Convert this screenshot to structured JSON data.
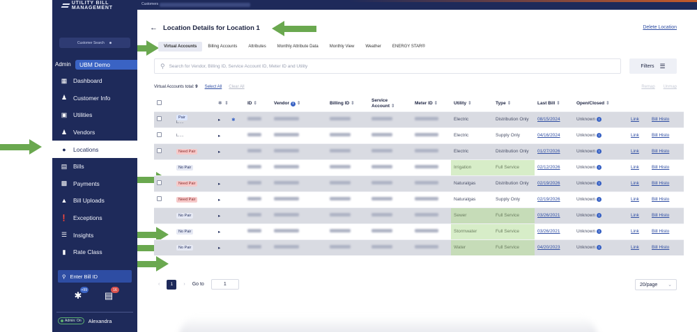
{
  "app": {
    "brand": "UTILITY BILL MANAGEMENT",
    "crumb": "Customers"
  },
  "sidebar": {
    "customer_search": "Customer Search",
    "admin_label": "Admin",
    "org_name": "UBM Demo",
    "items": [
      {
        "label": "Dashboard",
        "icon": "dashboard-icon"
      },
      {
        "label": "Customer Info",
        "icon": "person-icon"
      },
      {
        "label": "Utilities",
        "icon": "lock-icon"
      },
      {
        "label": "Vendors",
        "icon": "person-icon"
      },
      {
        "label": "Locations",
        "icon": "pin-icon",
        "active": true
      },
      {
        "label": "Bills",
        "icon": "bill-icon"
      },
      {
        "label": "Payments",
        "icon": "payment-icon"
      },
      {
        "label": "Bill Uploads",
        "icon": "upload-icon"
      },
      {
        "label": "Exceptions",
        "icon": "alert-icon"
      },
      {
        "label": "Insights",
        "icon": "insights-icon"
      },
      {
        "label": "Rate Class",
        "icon": "rate-icon"
      }
    ],
    "bill_id_placeholder": "Enter Bill ID",
    "notif_badge_1": "+99",
    "notif_badge_2": "16",
    "admin_pill": "Admin: On",
    "user_name": "Alexandra"
  },
  "page": {
    "title": "Location Details for Location 1",
    "delete_link": "Delete Location",
    "tabs": [
      "Virtual Accounts",
      "Billing Accounts",
      "Attributes",
      "Monthly Attribute Data",
      "Monthly View",
      "Weather",
      "ENERGY STAR®"
    ],
    "search_placeholder": "Search for Vendor, Billing ID, Service Account ID, Meter ID and Utility",
    "filters_label": "Filters",
    "totals_label": "Virtual Accounts total:",
    "totals_count": "9",
    "select_all": "Select All",
    "clear_all": "Clear All",
    "remap": "Remap",
    "unmap": "Unmap"
  },
  "table": {
    "headers": [
      "ID",
      "Vendor",
      "Billing ID",
      "Service Account",
      "Meter ID",
      "Utility",
      "Type",
      "Last Bill",
      "Open/Closed"
    ],
    "rows": [
      {
        "pair": "Pair",
        "pair_type": "pair",
        "sub": "L.....",
        "utility": "Electric",
        "type": "Distribution Only",
        "last_bill": "08/15/2024",
        "status": "Unknown",
        "shade": true
      },
      {
        "pair": "",
        "pair_type": "",
        "sub": "L.....",
        "utility": "Electric",
        "type": "Supply Only",
        "last_bill": "04/16/2024",
        "status": "Unknown",
        "shade": false
      },
      {
        "pair": "Need Pair",
        "pair_type": "need",
        "sub": "",
        "utility": "Electric",
        "type": "Distribution Only",
        "last_bill": "01/27/2026",
        "status": "Unknown",
        "shade": true
      },
      {
        "pair": "No Pair",
        "pair_type": "no",
        "sub": "",
        "utility": "Irrigation",
        "type": "Full Service",
        "last_bill": "02/12/2026",
        "status": "Unknown",
        "shade": false,
        "green": true
      },
      {
        "pair": "Need Pair",
        "pair_type": "need",
        "sub": "",
        "utility": "Naturalgas",
        "type": "Distribution Only",
        "last_bill": "02/19/2026",
        "status": "Unknown",
        "shade": true
      },
      {
        "pair": "Need Pair",
        "pair_type": "need",
        "sub": "",
        "utility": "Naturalgas",
        "type": "Supply Only",
        "last_bill": "02/19/2026",
        "status": "Unknown",
        "shade": false
      },
      {
        "pair": "No Pair",
        "pair_type": "no",
        "sub": "",
        "utility": "Sewer",
        "type": "Full Service",
        "last_bill": "03/26/2021",
        "status": "Unknown",
        "shade": true,
        "green": true
      },
      {
        "pair": "No Pair",
        "pair_type": "no",
        "sub": "",
        "utility": "Stormwater",
        "type": "Full Service",
        "last_bill": "03/26/2021",
        "status": "Unknown",
        "shade": false,
        "green": true
      },
      {
        "pair": "No Pair",
        "pair_type": "no",
        "sub": "",
        "utility": "Water",
        "type": "Full Service",
        "last_bill": "04/20/2023",
        "status": "Unknown",
        "shade": true,
        "green": true
      }
    ],
    "link_label": "Link",
    "bill_history_label": "Bill Histo"
  },
  "pager": {
    "current": "1",
    "goto_label": "Go to",
    "goto_value": "1",
    "page_size": "20/page"
  },
  "colors": {
    "sidebar": "#1e2a5a",
    "accent": "#3a63c4",
    "annotation_arrow": "#6aa84f"
  }
}
